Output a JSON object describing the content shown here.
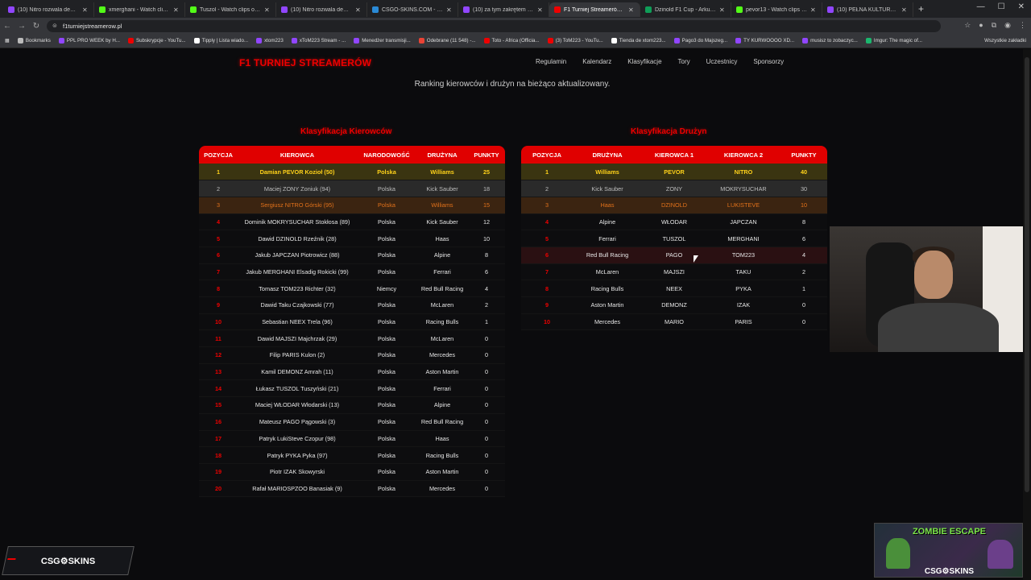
{
  "browser": {
    "tabs": [
      {
        "title": "(10) Nitro rozwala demonza",
        "color": "#9146ff"
      },
      {
        "title": "xmerghani - Watch clips on K",
        "color": "#53fc18"
      },
      {
        "title": "Tuszol - Watch clips on Kick",
        "color": "#53fc18"
      },
      {
        "title": "(10) Nitro rozwala demonza",
        "color": "#9146ff"
      },
      {
        "title": "CSGO-SKINS.COM - Najlepsz",
        "color": "#2a8ad6"
      },
      {
        "title": "(10) za tym zakrętem xDXDD",
        "color": "#9146ff"
      },
      {
        "title": "F1 Turniej Streamerów - Wall",
        "color": "#e00"
      },
      {
        "title": "Dzinold F1 Cup - Arkusze Go",
        "color": "#0f9d58"
      },
      {
        "title": "pevor13 - Watch clips on Kick",
        "color": "#53fc18"
      },
      {
        "title": "(10) PEŁNA KULTURA - Twitch",
        "color": "#9146ff"
      }
    ],
    "url": "f1turniejstreamerow.pl",
    "bookmarks": [
      {
        "label": "Bookmarks",
        "color": "#bbb"
      },
      {
        "label": "PPL PRO WEEK by H...",
        "color": "#9146ff"
      },
      {
        "label": "Subskrypcje - YouTu...",
        "color": "#e00"
      },
      {
        "label": "Tipply | Lista wiado...",
        "color": "#fff"
      },
      {
        "label": "xtom223",
        "color": "#9146ff"
      },
      {
        "label": "xToM223 Stream - ...",
        "color": "#9146ff"
      },
      {
        "label": "Menedżer transmisji...",
        "color": "#9146ff"
      },
      {
        "label": "Odebrane (11 548) -...",
        "color": "#ea4335"
      },
      {
        "label": "Toto - Africa (Officia...",
        "color": "#e00"
      },
      {
        "label": "(3) ToM223 - YouTu...",
        "color": "#e00"
      },
      {
        "label": "Tienda de xtom223...",
        "color": "#fff"
      },
      {
        "label": "Pago3 do Majszeg...",
        "color": "#9146ff"
      },
      {
        "label": "TY KURWOOOO XD...",
        "color": "#9146ff"
      },
      {
        "label": "musisz to zobaczyc...",
        "color": "#9146ff"
      },
      {
        "label": "Imgur: The magic of...",
        "color": "#1bb76e"
      }
    ],
    "bookmarks_right": "Wszystkie zakładki"
  },
  "site": {
    "logo": "F1 TURNIEJ STREAMERÓW",
    "nav": [
      "Regulamin",
      "Kalendarz",
      "Klasyfikacje",
      "Tory",
      "Uczestnicy",
      "Sponsorzy"
    ],
    "subtitle": "Ranking kierowców i drużyn na bieżąco aktualizowany."
  },
  "drivers": {
    "title": "Klasyfikacja Kierowców",
    "columns": [
      "POZYCJA",
      "KIEROWCA",
      "NARODOWOŚĆ",
      "DRUŻYNA",
      "PUNKTY"
    ],
    "rows": [
      [
        "1",
        "Damian PEVOR Kozioł (50)",
        "Polska",
        "Williams",
        "25"
      ],
      [
        "2",
        "Maciej ZONY Zoniuk (94)",
        "Polska",
        "Kick Sauber",
        "18"
      ],
      [
        "3",
        "Sergiusz NITRO Górski (95)",
        "Polska",
        "Williams",
        "15"
      ],
      [
        "4",
        "Dominik MOKRYSUCHAR Stokłosa (89)",
        "Polska",
        "Kick Sauber",
        "12"
      ],
      [
        "5",
        "Dawid DZINOLD Rzeźnik (28)",
        "Polska",
        "Haas",
        "10"
      ],
      [
        "6",
        "Jakub JAPCZAN Piotrowicz (88)",
        "Polska",
        "Alpine",
        "8"
      ],
      [
        "7",
        "Jakub MERGHANI Elsadig Rokicki (99)",
        "Polska",
        "Ferrari",
        "6"
      ],
      [
        "8",
        "Tomasz TOM223 Richter (32)",
        "Niemcy",
        "Red Bull Racing",
        "4"
      ],
      [
        "9",
        "Dawid Taku Czajkowski (77)",
        "Polska",
        "McLaren",
        "2"
      ],
      [
        "10",
        "Sebastian NEEX Trela (96)",
        "Polska",
        "Racing Bulls",
        "1"
      ],
      [
        "11",
        "Dawid MAJSZI Majchrzak (29)",
        "Polska",
        "McLaren",
        "0"
      ],
      [
        "12",
        "Filip PARIS Kulon (2)",
        "Polska",
        "Mercedes",
        "0"
      ],
      [
        "13",
        "Kamil DEMONZ Amrah (11)",
        "Polska",
        "Aston Martin",
        "0"
      ],
      [
        "14",
        "Łukasz TUSZOL Tuszyński (21)",
        "Polska",
        "Ferrari",
        "0"
      ],
      [
        "15",
        "Maciej WŁODAR Włodarski (13)",
        "Polska",
        "Alpine",
        "0"
      ],
      [
        "16",
        "Mateusz PAGO Pągowski (3)",
        "Polska",
        "Red Bull Racing",
        "0"
      ],
      [
        "17",
        "Patryk LukiSteve Czopur (98)",
        "Polska",
        "Haas",
        "0"
      ],
      [
        "18",
        "Patryk PYKA Pyka (97)",
        "Polska",
        "Racing Bulls",
        "0"
      ],
      [
        "19",
        "Piotr IZAK Skowyrski",
        "Polska",
        "Aston Martin",
        "0"
      ],
      [
        "20",
        "Rafał MARIOSPZOO Banasiak (9)",
        "Polska",
        "Mercedes",
        "0"
      ]
    ]
  },
  "teams": {
    "title": "Klasyfikacja Drużyn",
    "columns": [
      "POZYCJA",
      "DRUŻYNA",
      "KIEROWCA 1",
      "KIEROWCA 2",
      "PUNKTY"
    ],
    "rows": [
      [
        "1",
        "Williams",
        "PEVOR",
        "NITRO",
        "40"
      ],
      [
        "2",
        "Kick Sauber",
        "ZONY",
        "MOKRYSUCHAR",
        "30"
      ],
      [
        "3",
        "Haas",
        "DZINOLD",
        "LUKISTEVE",
        "10"
      ],
      [
        "4",
        "Alpine",
        "WŁODAR",
        "JAPCZAN",
        "8"
      ],
      [
        "5",
        "Ferrari",
        "TUSZOL",
        "MERGHANI",
        "6"
      ],
      [
        "6",
        "Red Bull Racing",
        "PAGO",
        "TOM223",
        "4"
      ],
      [
        "7",
        "McLaren",
        "MAJSZI",
        "TAKU",
        "2"
      ],
      [
        "8",
        "Racing Bulls",
        "NEEX",
        "PYKA",
        "1"
      ],
      [
        "9",
        "Aston Martin",
        "DEMONZ",
        "IZAK",
        "0"
      ],
      [
        "10",
        "Mercedes",
        "MARIO",
        "PARIS",
        "0"
      ]
    ]
  },
  "overlay": {
    "ad_left": "CSG⚙SKINS",
    "ad_right_title": "ZOMBIE ESCAPE",
    "ad_right_brand": "CSG⚙SKINS"
  }
}
